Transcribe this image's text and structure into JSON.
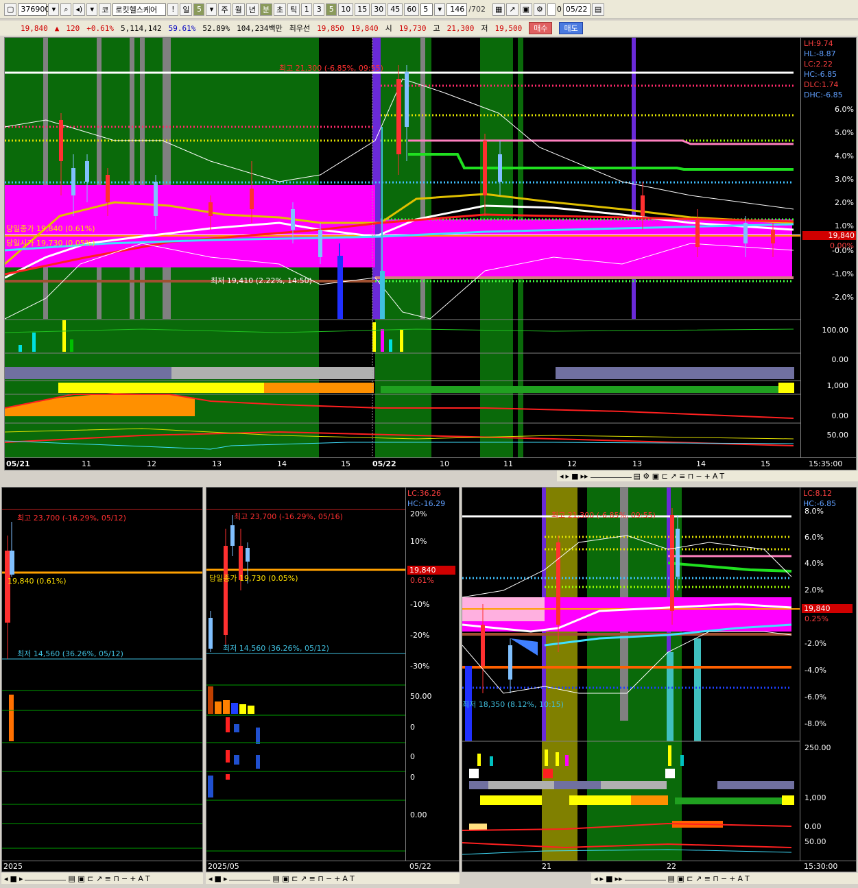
{
  "toolbar": {
    "code": "376900",
    "name_prefix": "코",
    "name": "로킷헬스케어",
    "btn_excl": "!",
    "period_day": "일",
    "period_num": "5",
    "week": "주",
    "month": "월",
    "year": "년",
    "minute": "분",
    "second": "초",
    "tick": "틱",
    "n1": "1",
    "n3": "3",
    "n5": "5",
    "n10": "10",
    "n15": "15",
    "n30": "30",
    "n45": "45",
    "n60": "60",
    "period_sel": "5",
    "count": "146",
    "count_total": "/702",
    "date_box": "0",
    "date": "05/22"
  },
  "quote": {
    "price": "19,840",
    "change": "120",
    "change_pct": "+0.61%",
    "volume": "5,114,142",
    "pct1": "59.61%",
    "pct2": "52.89%",
    "amount": "104,234백만",
    "best_ask_label": "최우선",
    "best_ask": "19,850",
    "best_bid": "19,840",
    "open_label": "시",
    "open": "19,730",
    "high_label": "고",
    "high": "21,300",
    "low_label": "저",
    "low": "19,500",
    "buy": "매수",
    "sell": "매도"
  },
  "main_chart": {
    "labels": {
      "high": "최고 21,300 (-6.85%, 09:55)",
      "low": "최저 19,410 (2.22%, 14:50)",
      "prev_close": "당일종가 19,840 (0.61%)",
      "today_open": "당일시가 19,730 (0.05%)"
    },
    "legend": [
      "LH:9.74",
      "HL:-8.87",
      "LC:2.22",
      "HC:-6.85",
      "DLC:1.74",
      "DHC:-6.85"
    ],
    "y_ticks": [
      "6.0%",
      "5.0%",
      "4.0%",
      "3.0%",
      "2.0%",
      "1.0%",
      "0.00%",
      "-0.0%",
      "-1.0%",
      "-2.0%"
    ],
    "price_box": "19,840",
    "price_pct": "0.00%",
    "sub_scales": [
      "100.00",
      "0.00",
      "1,000",
      "0.00",
      "50.00"
    ],
    "x_labels": [
      "05/21",
      "11",
      "12",
      "13",
      "14",
      "15",
      "05/22",
      "10",
      "11",
      "12",
      "13",
      "14",
      "15"
    ],
    "time": "15:35:00"
  },
  "left1": {
    "high": "최고 23,700 (-16.29%, 05/12)",
    "close": "19,840 (0.61%)",
    "low": "최저 14,560 (36.26%, 05/12)",
    "x_label": "2025"
  },
  "left2": {
    "high": "최고 23,700 (-16.29%, 05/16)",
    "close": "당일종가 19,730 (0.05%)",
    "low": "최저 14,560 (36.26%, 05/12)",
    "legend": [
      "LC:36.26",
      "HC:-16.29"
    ],
    "y_ticks": [
      "20%",
      "10%",
      "0%",
      "-10%",
      "-20%",
      "-30%"
    ],
    "price_box": "19,840",
    "price_pct": "0.61%",
    "sub_scales": [
      "50.00",
      "0",
      "0",
      "0",
      "0.00"
    ],
    "x_label": "2025/05",
    "x_right": "05/22"
  },
  "right": {
    "high": "최고 21,300 (-6.85%, 09:55)",
    "low": "최저 18,350 (8.12%, 10:15)",
    "legend": [
      "LC:8.12",
      "HC:-6.85"
    ],
    "y_ticks": [
      "8.0%",
      "6.0%",
      "4.0%",
      "2.0%",
      "-2.0%",
      "-4.0%",
      "-6.0%",
      "-8.0%"
    ],
    "price_box": "19,840",
    "price_pct": "0.25%",
    "sub_scales": [
      "250.00",
      "1,000",
      "0.00",
      "50.00"
    ],
    "x_labels": [
      "21",
      "22"
    ],
    "time": "15:30:00"
  },
  "mini": {
    "plus": "+",
    "minus": "−",
    "a": "A",
    "t": "T"
  }
}
